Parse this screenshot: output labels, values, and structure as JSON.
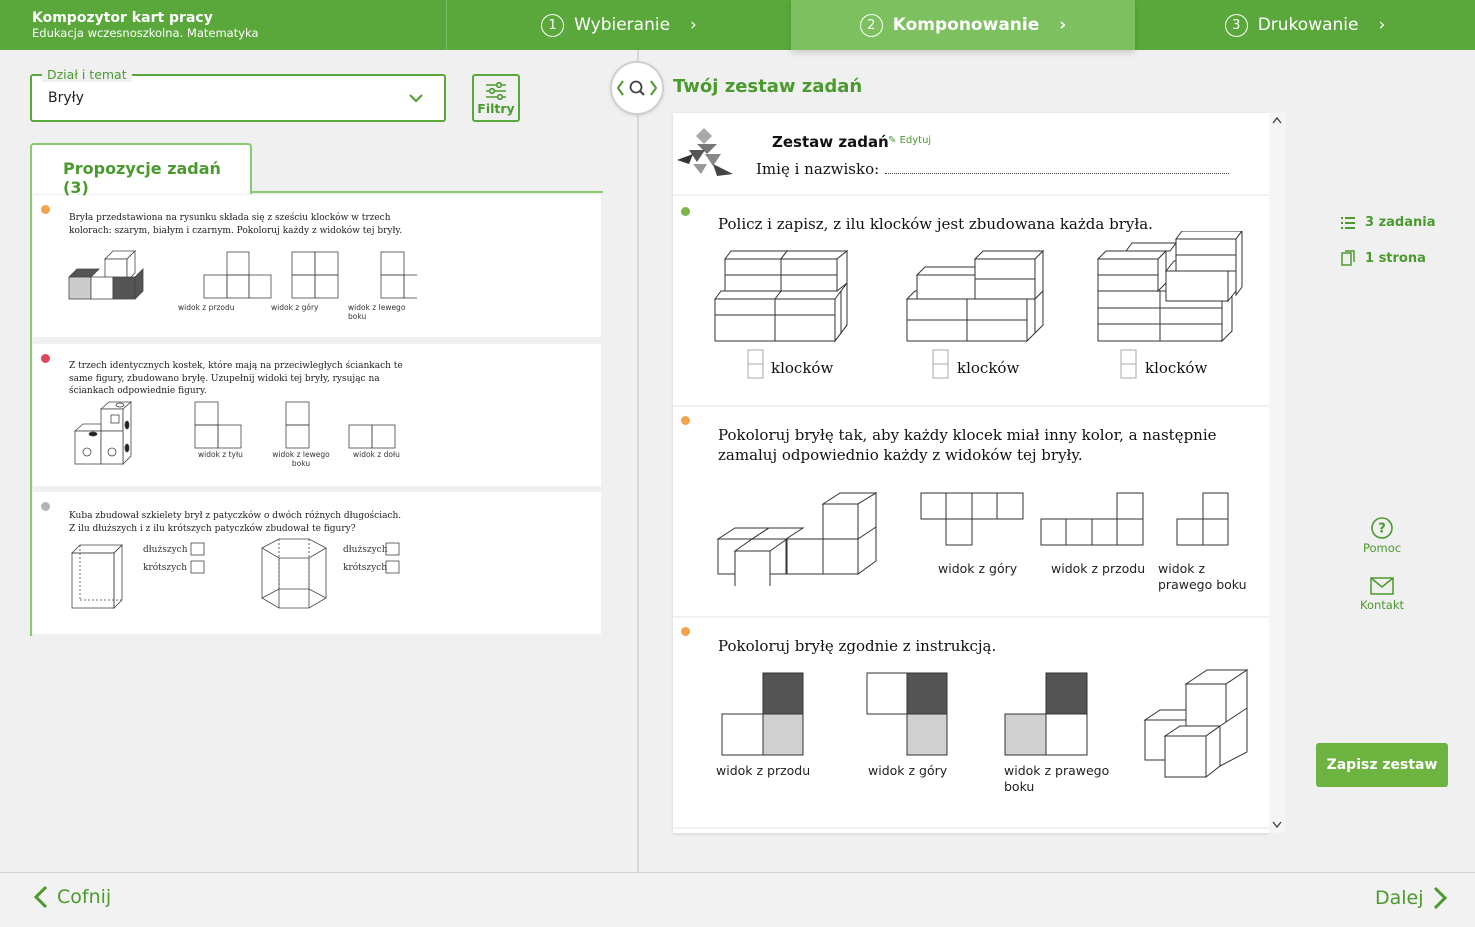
{
  "app": {
    "title": "Kompozytor kart pracy",
    "subtitle": "Edukacja wczesnoszkolna. Matematyka"
  },
  "steps": [
    {
      "num": "1",
      "label": "Wybieranie",
      "active": false
    },
    {
      "num": "2",
      "label": "Komponowanie",
      "active": true
    },
    {
      "num": "3",
      "label": "Drukowanie",
      "active": false
    }
  ],
  "topic_select": {
    "label": "Dział i temat",
    "value": "Bryły"
  },
  "filters_label": "Filtry",
  "proposals_tab": "Propozycje zadań (3)",
  "proposals": [
    {
      "dot_color": "#f4a24b",
      "text": "Bryła przedstawiona na rysunku składa się z sześciu klocków w trzech kolorach: szarym, białym i czarnym. Pokoloruj każdy z widoków tej bryły.",
      "labels": [
        "widok z przodu",
        "widok z góry",
        "widok z lewego boku"
      ]
    },
    {
      "dot_color": "#e0465a",
      "text": "Z trzech identycznych kostek, które mają na przeciwległych ściankach te same figury, zbudowano bryłę. Uzupełnij widoki tej bryły, rysując na ściankach odpowiednie figury.",
      "labels": [
        "widok z tyłu",
        "widok z lewego boku",
        "widok z dołu"
      ]
    },
    {
      "dot_color": "#b5b5b5",
      "text": "Kuba zbudował szkielety brył z patyczków o dwóch różnych długościach. Z ilu dłuższych i z ilu krótszych patyczków zbudował te figury?",
      "labels": [
        "dłuższych",
        "krótszych",
        "dłuższych",
        "krótszych"
      ]
    }
  ],
  "set_title": "Twój zestaw zadań",
  "worksheet": {
    "title": "Zestaw zadań",
    "edit_label": "Edytuj",
    "name_label": "Imię i nazwisko:",
    "tasks": [
      {
        "dot_color": "#7ab648",
        "text": "Policz i zapisz, z ilu klocków jest zbudowana każda bryła.",
        "labels": [
          "klocków",
          "klocków",
          "klocków"
        ]
      },
      {
        "dot_color": "#f4a24b",
        "text": "Pokoloruj bryłę tak, aby każdy klocek miał inny kolor, a następnie zamaluj odpowiednio każdy z widoków tej bryły.",
        "labels": [
          "widok z góry",
          "widok z przodu",
          "widok z prawego boku"
        ]
      },
      {
        "dot_color": "#f4a24b",
        "text": "Pokoloruj bryłę zgodnie z instrukcją.",
        "labels": [
          "widok z przodu",
          "widok z góry",
          "widok z prawego boku"
        ]
      }
    ]
  },
  "stats": {
    "tasks_count": "3 zadania",
    "pages_count": "1 strona"
  },
  "help_label": "Pomoc",
  "contact_label": "Kontakt",
  "save_label": "Zapisz zestaw",
  "back_label": "Cofnij",
  "next_label": "Dalej",
  "colors": {
    "accent": "#5aa83c",
    "accent_light": "#7cc05f",
    "button": "#6cb33f"
  }
}
